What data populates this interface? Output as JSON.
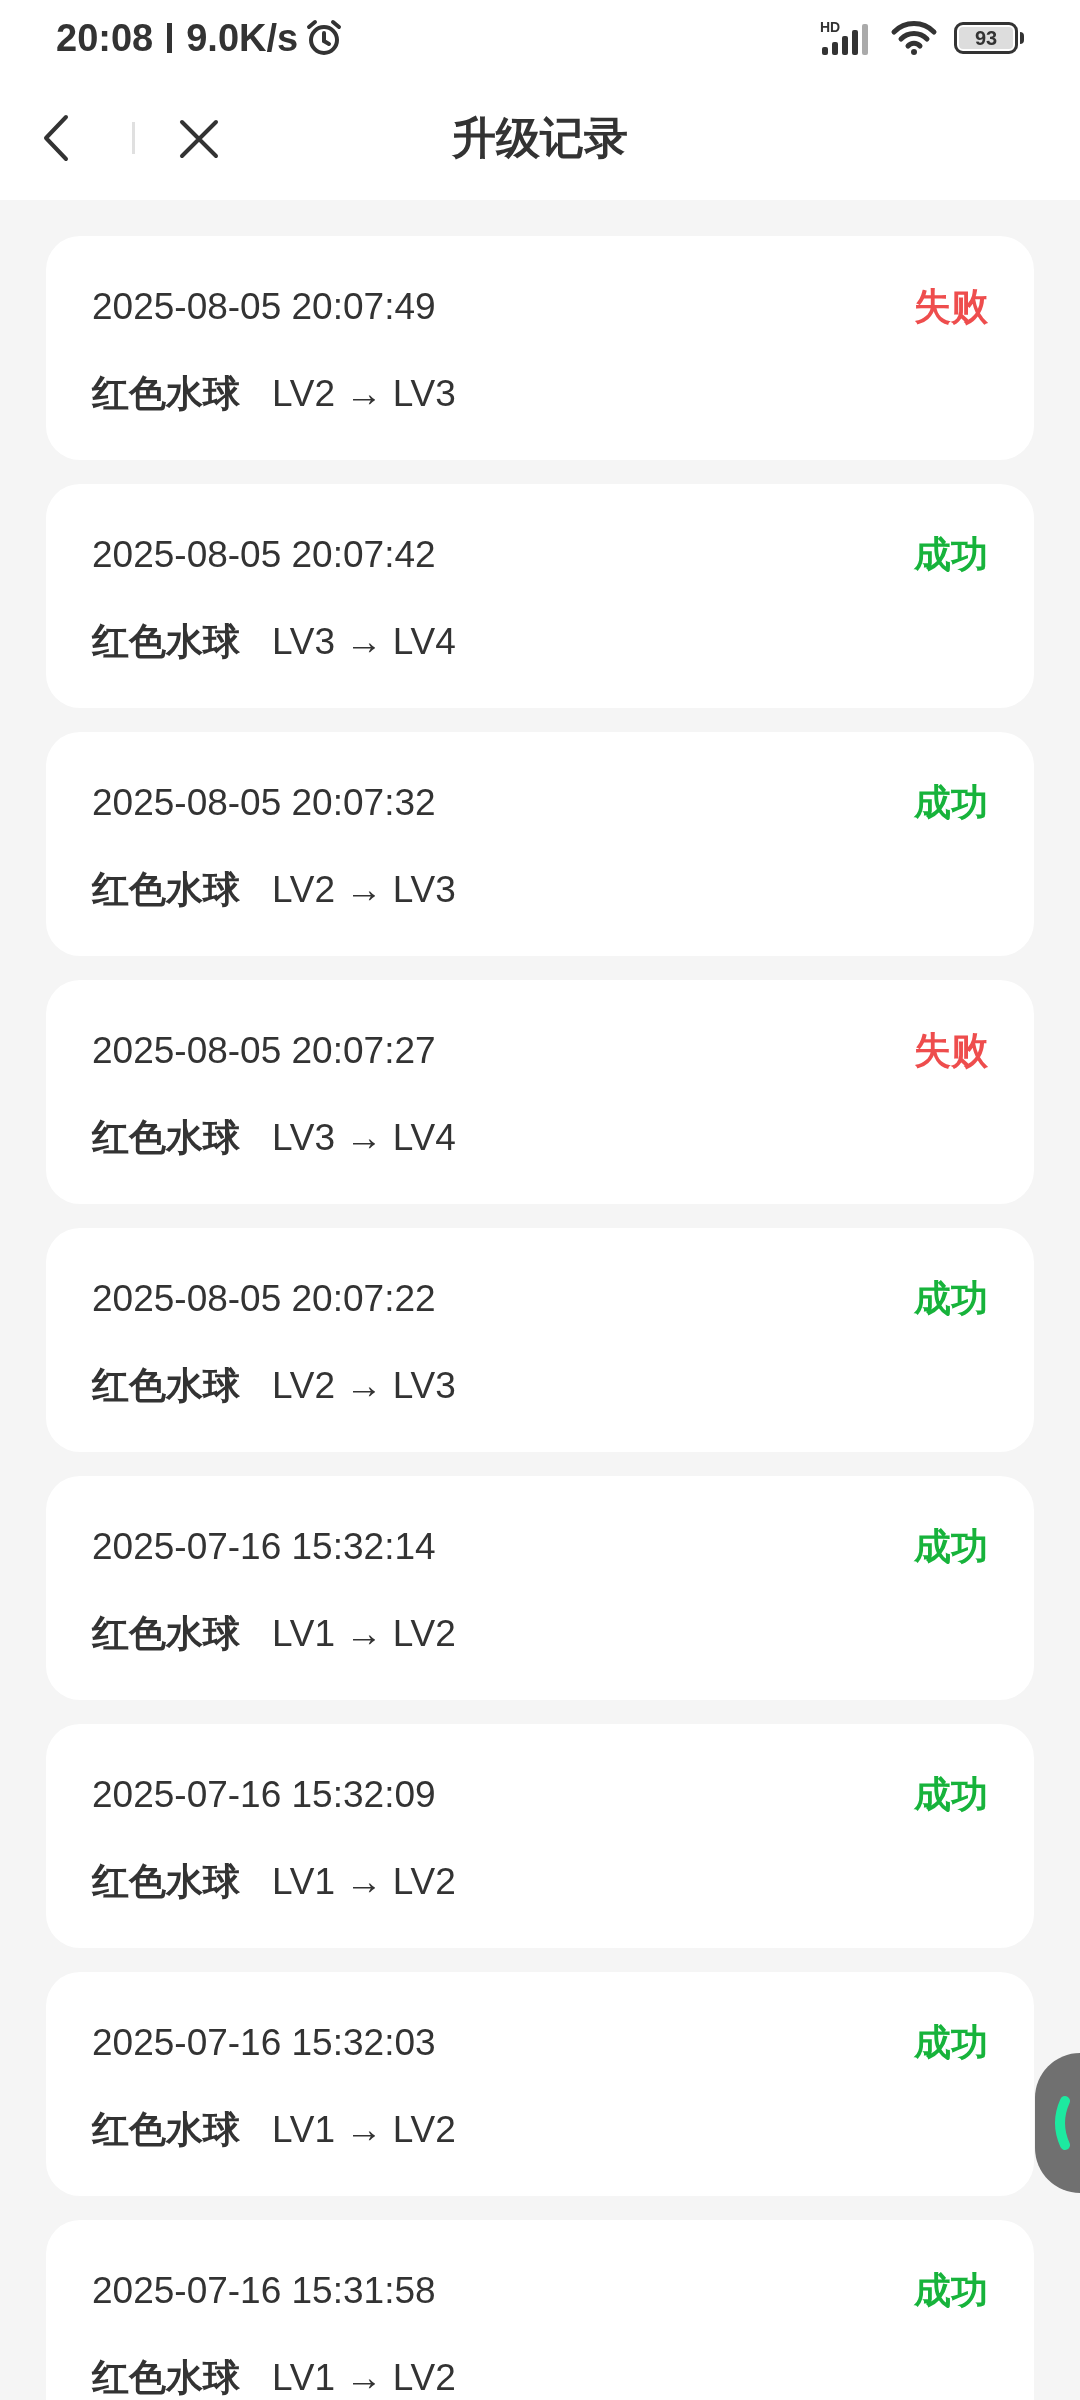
{
  "status_bar": {
    "time": "20:08",
    "speed": "9.0K/s",
    "network": "HD",
    "battery": "93"
  },
  "header": {
    "title": "升级记录"
  },
  "records": [
    {
      "time": "2025-08-05 20:07:49",
      "result": "失败",
      "kind": "fail",
      "item": "红色水球",
      "change": "LV2 → LV3"
    },
    {
      "time": "2025-08-05 20:07:42",
      "result": "成功",
      "kind": "success",
      "item": "红色水球",
      "change": "LV3 → LV4"
    },
    {
      "time": "2025-08-05 20:07:32",
      "result": "成功",
      "kind": "success",
      "item": "红色水球",
      "change": "LV2 → LV3"
    },
    {
      "time": "2025-08-05 20:07:27",
      "result": "失败",
      "kind": "fail",
      "item": "红色水球",
      "change": "LV3 → LV4"
    },
    {
      "time": "2025-08-05 20:07:22",
      "result": "成功",
      "kind": "success",
      "item": "红色水球",
      "change": "LV2 → LV3"
    },
    {
      "time": "2025-07-16 15:32:14",
      "result": "成功",
      "kind": "success",
      "item": "红色水球",
      "change": "LV1 → LV2"
    },
    {
      "time": "2025-07-16 15:32:09",
      "result": "成功",
      "kind": "success",
      "item": "红色水球",
      "change": "LV1 → LV2"
    },
    {
      "time": "2025-07-16 15:32:03",
      "result": "成功",
      "kind": "success",
      "item": "红色水球",
      "change": "LV1 → LV2"
    },
    {
      "time": "2025-07-16 15:31:58",
      "result": "成功",
      "kind": "success",
      "item": "红色水球",
      "change": "LV1 → LV2"
    }
  ]
}
